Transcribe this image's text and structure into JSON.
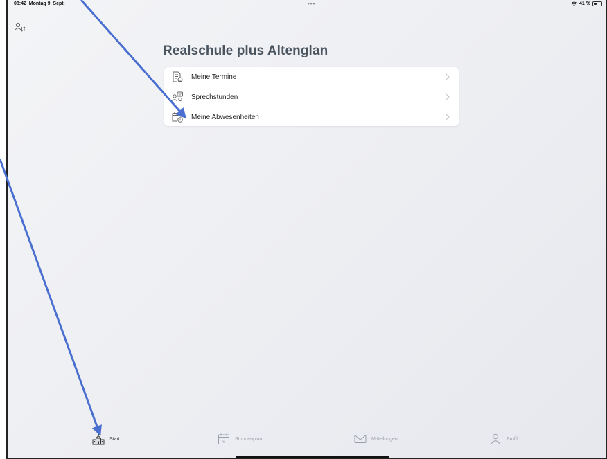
{
  "status_bar": {
    "time": "08:42",
    "date": "Montag 9. Sept.",
    "dots": "•••",
    "battery": "41 %",
    "battery_level": 0.41
  },
  "header": {
    "switch_user_icon": "user-switch-icon"
  },
  "main": {
    "school_name": "Realschule plus Altenglan",
    "menu": [
      {
        "label": "Meine Termine",
        "icon": "appointments-icon"
      },
      {
        "label": "Sprechstunden",
        "icon": "consultation-icon"
      },
      {
        "label": "Meine Abwesenheiten",
        "icon": "absences-icon"
      }
    ]
  },
  "tabbar": {
    "tabs": [
      {
        "label": "Start",
        "icon": "school-icon",
        "active": true
      },
      {
        "label": "Stundenplan",
        "icon": "calendar-icon",
        "active": false
      },
      {
        "label": "Mitteilungen",
        "icon": "mail-icon",
        "active": false
      },
      {
        "label": "Profil",
        "icon": "person-icon",
        "active": false
      }
    ]
  },
  "colors": {
    "title": "#4a5560",
    "annotation_arrow": "#4a6fd0",
    "inactive_tab": "#9aa0aa",
    "active_tab": "#333333"
  }
}
